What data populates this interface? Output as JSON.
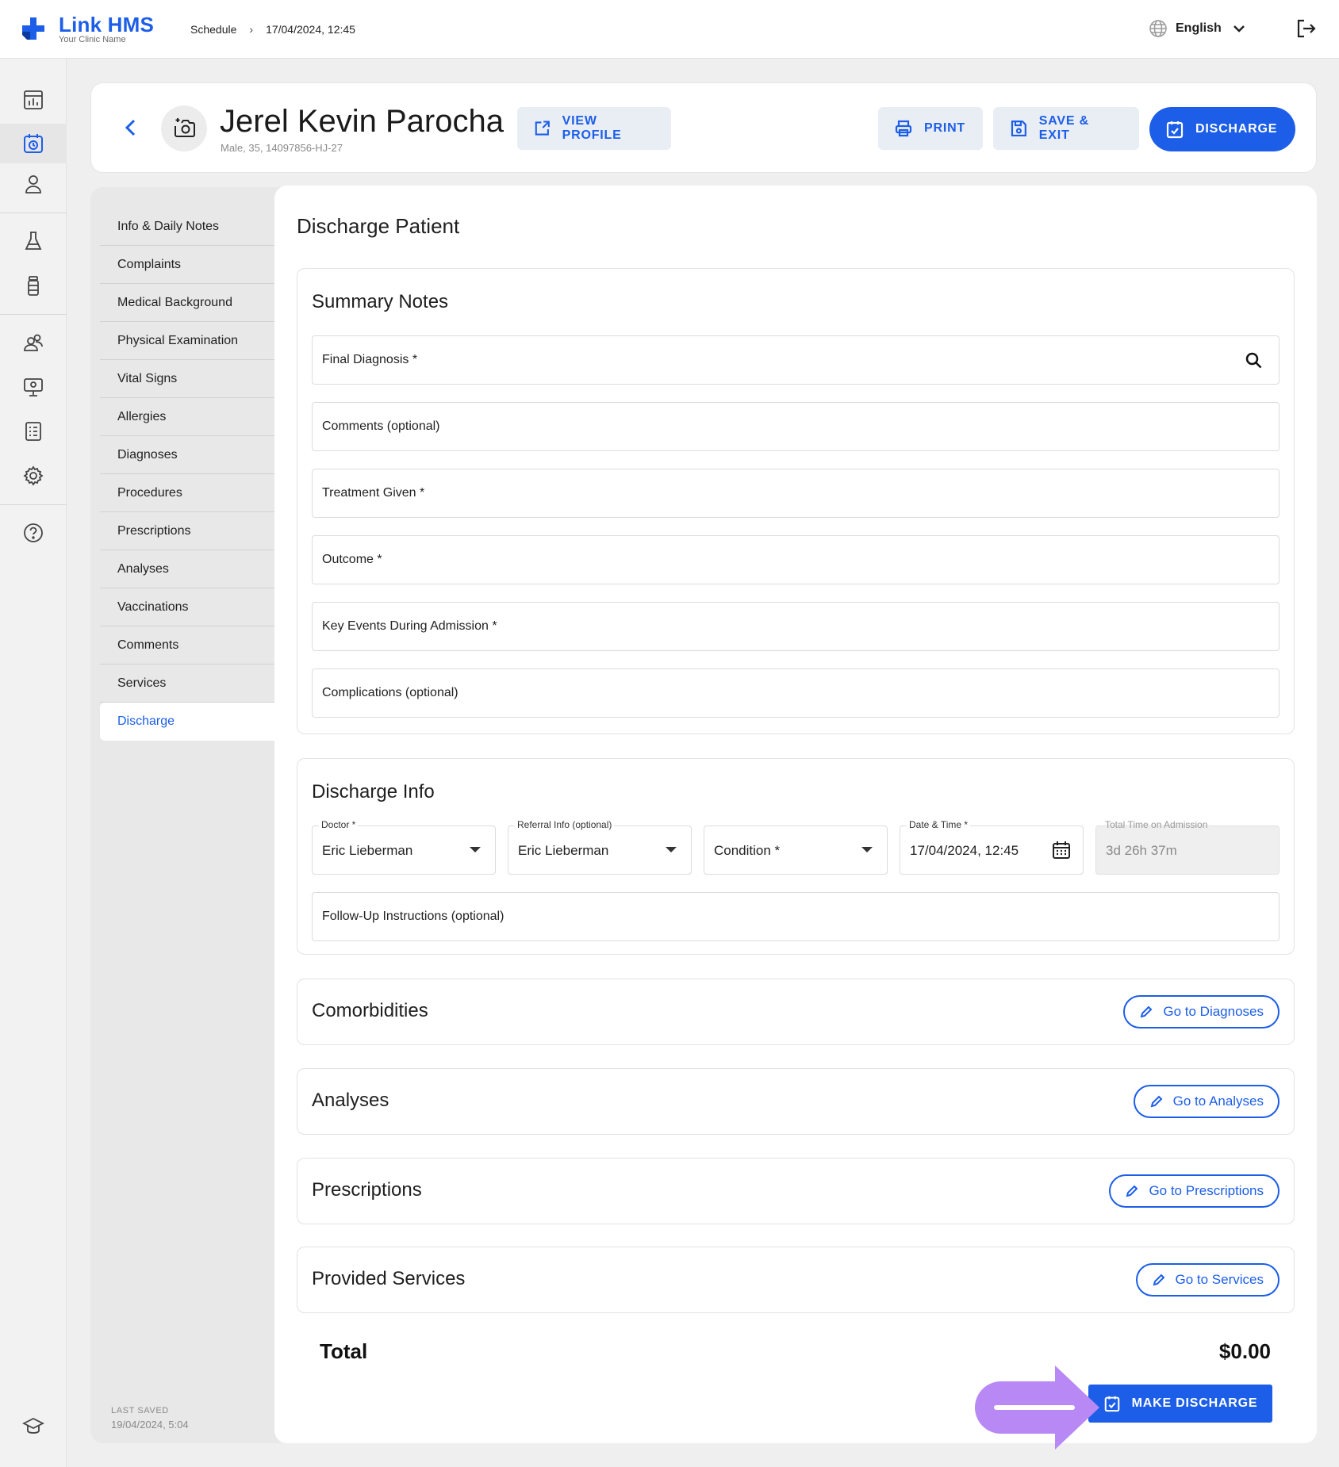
{
  "app": {
    "brand": "Link HMS",
    "clinic": "Your Clinic Name"
  },
  "breadcrumb": {
    "section": "Schedule",
    "separator": "›",
    "current": "17/04/2024, 12:45"
  },
  "language": {
    "selected": "English"
  },
  "patient": {
    "name": "Jerel Kevin Parocha",
    "meta": "Male, 35, 14097856-HJ-27"
  },
  "header_actions": {
    "view_profile": "VIEW PROFILE",
    "print": "PRINT",
    "save_exit": "SAVE & EXIT",
    "discharge": "DISCHARGE"
  },
  "nav": {
    "items": [
      "Info & Daily Notes",
      "Complaints",
      "Medical Background",
      "Physical Examination",
      "Vital Signs",
      "Allergies",
      "Diagnoses",
      "Procedures",
      "Prescriptions",
      "Analyses",
      "Vaccinations",
      "Comments",
      "Services",
      "Discharge"
    ],
    "active": "Discharge",
    "last_saved_label": "LAST SAVED",
    "last_saved_value": "19/04/2024, 5:04"
  },
  "page": {
    "title": "Discharge Patient"
  },
  "summary": {
    "title": "Summary Notes",
    "fields": [
      "Final Diagnosis *",
      "Comments (optional)",
      "Treatment Given *",
      "Outcome *",
      "Key Events During Admission *",
      "Complications (optional)"
    ]
  },
  "discharge_info": {
    "title": "Discharge Info",
    "doctor": {
      "label": "Doctor *",
      "value": "Eric Lieberman"
    },
    "referral": {
      "label": "Referral Info (optional)",
      "value": "Eric Lieberman"
    },
    "condition": {
      "value": "Condition *"
    },
    "datetime": {
      "label": "Date & Time *",
      "value": "17/04/2024, 12:45"
    },
    "total_time": {
      "label": "Total Time on Admission",
      "value": "3d 26h 37m"
    },
    "follow_up": "Follow-Up Instructions (optional)"
  },
  "sections": [
    {
      "title": "Comorbidities",
      "button": "Go to Diagnoses"
    },
    {
      "title": "Analyses",
      "button": "Go to Analyses"
    },
    {
      "title": "Prescriptions",
      "button": "Go to Prescriptions"
    },
    {
      "title": "Provided Services",
      "button": "Go to Services"
    }
  ],
  "total": {
    "label": "Total",
    "value": "$0.00"
  },
  "make_discharge": "MAKE DISCHARGE",
  "colors": {
    "accent": "#1c5ee8",
    "annotation_arrow": "#b889f4"
  }
}
